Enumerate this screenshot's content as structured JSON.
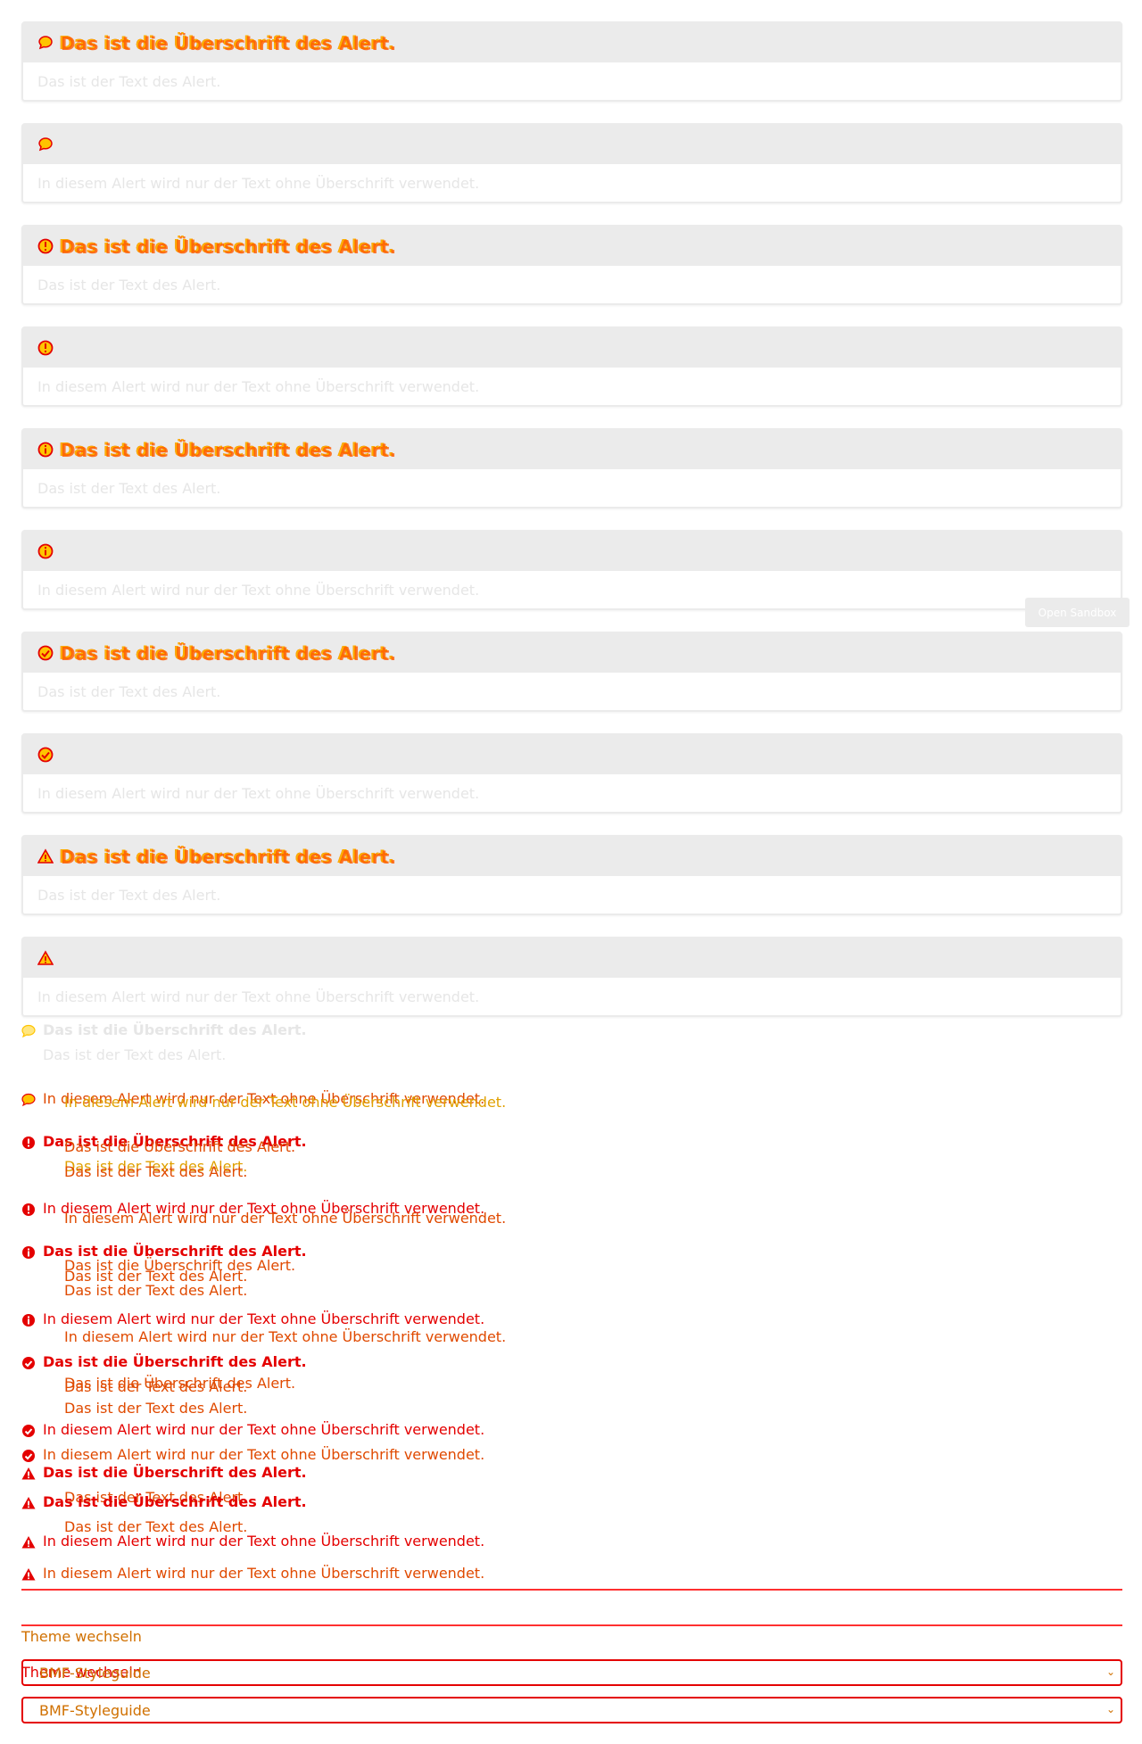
{
  "alerts": [
    {
      "icon": "chat-bubble-icon",
      "title": "Das ist die Überschrift des Alert.",
      "text": "Das ist der Text des Alert."
    },
    {
      "icon": "chat-bubble-icon",
      "title": "",
      "text": "In diesem Alert wird nur der Text ohne Überschrift verwendet."
    },
    {
      "icon": "exclamation-circle-icon",
      "title": "Das ist die Überschrift des Alert.",
      "text": "Das ist der Text des Alert."
    },
    {
      "icon": "exclamation-circle-icon",
      "title": "",
      "text": "In diesem Alert wird nur der Text ohne Überschrift verwendet."
    },
    {
      "icon": "info-circle-icon",
      "title": "Das ist die Überschrift des Alert.",
      "text": "Das ist der Text des Alert."
    },
    {
      "icon": "info-circle-icon",
      "title": "",
      "text": "In diesem Alert wird nur der Text ohne Überschrift verwendet."
    },
    {
      "icon": "check-circle-icon",
      "title": "Das ist die Überschrift des Alert.",
      "text": "Das ist der Text des Alert."
    },
    {
      "icon": "check-circle-icon",
      "title": "",
      "text": "In diesem Alert wird nur der Text ohne Überschrift verwendet."
    },
    {
      "icon": "warning-triangle-icon",
      "title": "Das ist die Überschrift des Alert.",
      "text": "Das ist der Text des Alert."
    },
    {
      "icon": "warning-triangle-icon",
      "title": "",
      "text": "In diesem Alert wird nur der Text ohne Überschrift verwendet."
    }
  ],
  "sandbox": {
    "label": "Open Sandbox"
  },
  "compact": {
    "title": "Das ist die Überschrift des Alert.",
    "text": "Das ist der Text des Alert.",
    "notitle": "In diesem Alert wird nur der Text ohne Überschrift verwendet."
  },
  "theme": {
    "label": "Theme wechseln",
    "value": "BMF-Styleguide"
  },
  "colors": {
    "accent": "#e40000",
    "highlight": "#ffc400",
    "surface": "#ebebeb"
  }
}
